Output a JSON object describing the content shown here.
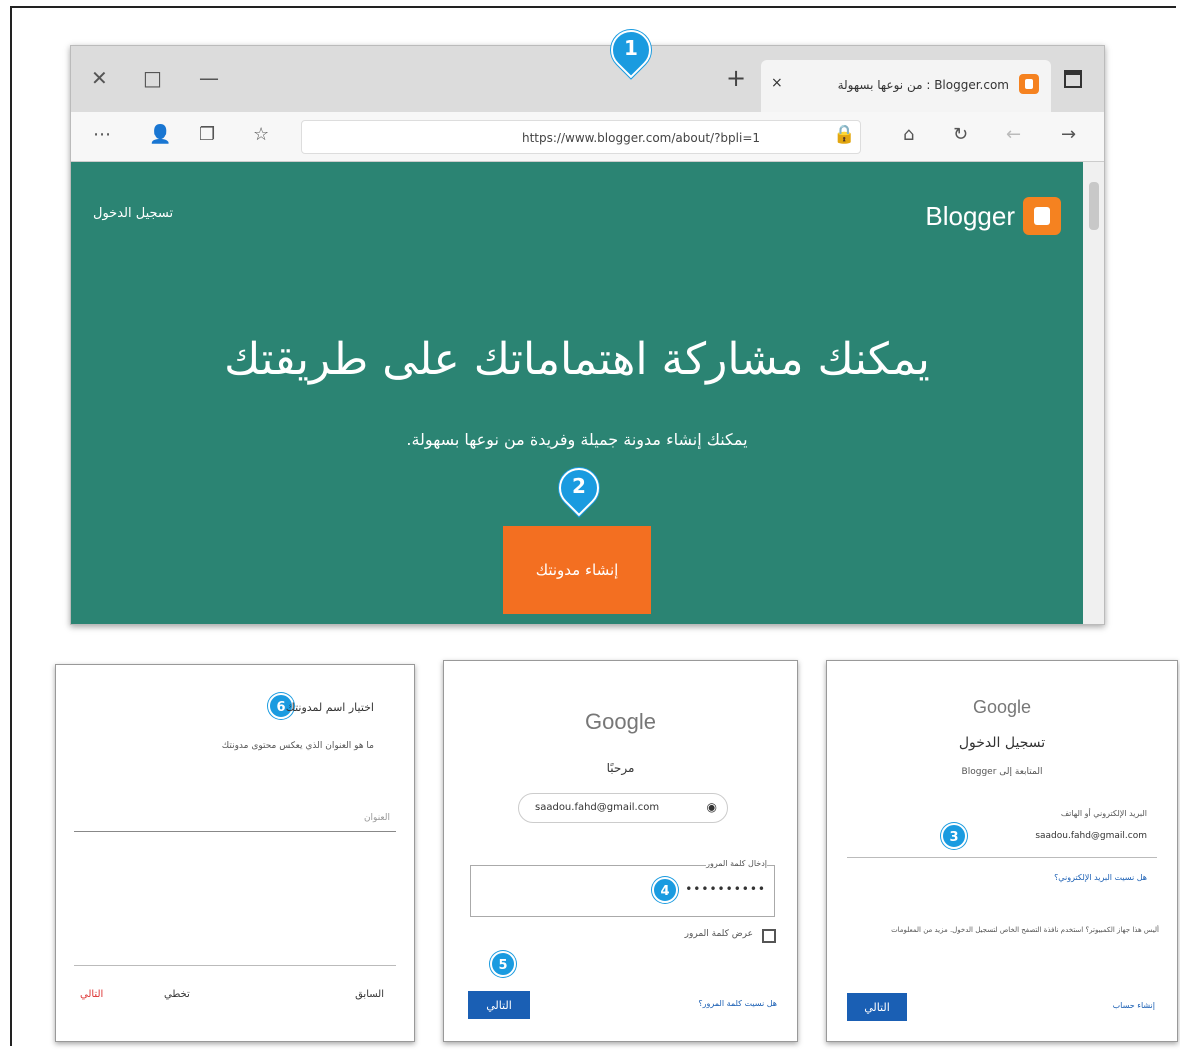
{
  "browser": {
    "tab_title": "Blogger.com : من نوعها بسهولة",
    "tab_close": "×",
    "new_tab": "+",
    "url": "https://www.blogger.com/about/?bpli=1",
    "min_glyph": "—",
    "max_glyph": "□",
    "close_glyph": "✕"
  },
  "blogger_page": {
    "sign_in": "تسجيل الدخول",
    "brand": "Blogger",
    "headline": "يمكنك مشاركة اهتماماتك على طريقتك",
    "subline": "يمكنك إنشاء مدونة جميلة وفريدة من نوعها بسهولة.",
    "cta": "إنشاء مدونتك"
  },
  "markers": [
    "1",
    "2",
    "3",
    "4",
    "5",
    "6"
  ],
  "panel_name": {
    "title": "اختيار اسم لمدونتك",
    "subtitle": "ما هو العنوان الذي يعكس محتوى مدونتك",
    "field_label": "العنوان",
    "back": "السابق",
    "skip": "تخطي",
    "next": "التالي"
  },
  "panel_password": {
    "logo": "Google",
    "welcome": "مرحبًا",
    "email": "saadou.fahd@gmail.com",
    "field_label": "إدخال كلمة المرور",
    "password": "••••••••••",
    "show_password": "عرض كلمة المرور",
    "forgot": "هل نسيت كلمة المرور؟",
    "next": "التالي"
  },
  "panel_signin": {
    "logo": "Google",
    "title": "تسجيل الدخول",
    "subtitle": "المتابعة إلى Blogger",
    "field_label": "البريد الإلكتروني أو الهاتف",
    "email": "saadou.fahd@gmail.com",
    "forgot": "هل نسيت البريد الإلكتروني؟",
    "note": "أليس هذا جهاز الكمبيوتر؟ استخدم نافذة التصفح الخاص لتسجيل الدخول. مزيد من المعلومات",
    "create": "إنشاء حساب",
    "next": "التالي"
  }
}
